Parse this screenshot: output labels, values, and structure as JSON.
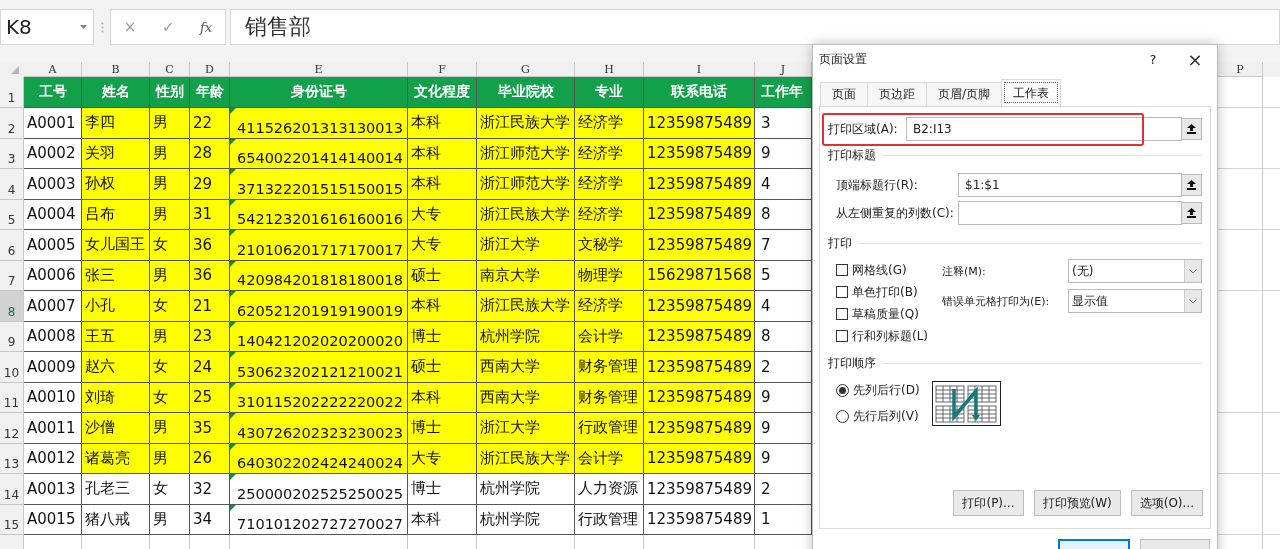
{
  "formula_bar": {
    "name_box": "K8",
    "buttons": [
      "×",
      "✓",
      "fx"
    ],
    "formula": "销售部"
  },
  "sheet": {
    "columns": [
      "A",
      "B",
      "C",
      "D",
      "E",
      "F",
      "G",
      "H",
      "I",
      "J"
    ],
    "far_column": "P",
    "header_row": {
      "row": "1",
      "cells": [
        "工号",
        "姓名",
        "性别",
        "年龄",
        "身份证号",
        "文化程度",
        "毕业院校",
        "专业",
        "联系电话",
        "工作年"
      ]
    },
    "rows": [
      {
        "row": "2",
        "active": false,
        "highlighted": true,
        "number_as_text": true,
        "cells": [
          "A0001",
          "李四",
          "男",
          "22",
          "411526201313130013",
          "本科",
          "浙江民族大学",
          "经济学",
          "12359875489",
          "3"
        ]
      },
      {
        "row": "3",
        "active": false,
        "highlighted": true,
        "number_as_text": true,
        "cells": [
          "A0002",
          "关羽",
          "男",
          "28",
          "654002201414140014",
          "本科",
          "浙江师范大学",
          "经济学",
          "12359875489",
          "9"
        ]
      },
      {
        "row": "4",
        "active": false,
        "highlighted": true,
        "number_as_text": true,
        "cells": [
          "A0003",
          "孙权",
          "男",
          "29",
          "371322201515150015",
          "本科",
          "浙江师范大学",
          "经济学",
          "12359875489",
          "4"
        ]
      },
      {
        "row": "5",
        "active": false,
        "highlighted": true,
        "number_as_text": true,
        "cells": [
          "A0004",
          "吕布",
          "男",
          "31",
          "542123201616160016",
          "大专",
          "浙江民族大学",
          "经济学",
          "12359875489",
          "8"
        ]
      },
      {
        "row": "6",
        "active": false,
        "highlighted": true,
        "number_as_text": true,
        "cells": [
          "A0005",
          "女儿国王",
          "女",
          "36",
          "210106201717170017",
          "大专",
          "浙江大学",
          "文秘学",
          "12359875489",
          "7"
        ]
      },
      {
        "row": "7",
        "active": false,
        "highlighted": true,
        "number_as_text": true,
        "cells": [
          "A0006",
          "张三",
          "男",
          "36",
          "420984201818180018",
          "硕士",
          "南京大学",
          "物理学",
          "15629871568",
          "5"
        ]
      },
      {
        "row": "8",
        "active": true,
        "highlighted": true,
        "number_as_text": true,
        "cells": [
          "A0007",
          "小孔",
          "女",
          "21",
          "620521201919190019",
          "本科",
          "浙江民族大学",
          "经济学",
          "12359875489",
          "4"
        ]
      },
      {
        "row": "9",
        "active": false,
        "highlighted": true,
        "number_as_text": true,
        "cells": [
          "A0008",
          "王五",
          "男",
          "23",
          "140421202020200020",
          "博士",
          "杭州学院",
          "会计学",
          "12359875489",
          "8"
        ]
      },
      {
        "row": "10",
        "active": false,
        "highlighted": true,
        "number_as_text": true,
        "cells": [
          "A0009",
          "赵六",
          "女",
          "24",
          "530623202121210021",
          "硕士",
          "西南大学",
          "财务管理",
          "12359875489",
          "2"
        ]
      },
      {
        "row": "11",
        "active": false,
        "highlighted": true,
        "number_as_text": true,
        "cells": [
          "A0010",
          "刘琦",
          "女",
          "25",
          "310115202222220022",
          "本科",
          "西南大学",
          "财务管理",
          "12359875489",
          "9"
        ]
      },
      {
        "row": "12",
        "active": false,
        "highlighted": true,
        "number_as_text": true,
        "cells": [
          "A0011",
          "沙僧",
          "男",
          "35",
          "430726202323230023",
          "博士",
          "浙江大学",
          "行政管理",
          "12359875489",
          "9"
        ]
      },
      {
        "row": "13",
        "active": false,
        "highlighted": true,
        "number_as_text": true,
        "cells": [
          "A0012",
          "诸葛亮",
          "男",
          "26",
          "640302202424240024",
          "大专",
          "浙江民族大学",
          "会计学",
          "12359875489",
          "9"
        ]
      },
      {
        "row": "14",
        "active": false,
        "highlighted": false,
        "number_as_text": true,
        "cells": [
          "A0013",
          "孔老三",
          "女",
          "32",
          "250000202525250025",
          "博士",
          "杭州学院",
          "人力资源",
          "12359875489",
          "2"
        ]
      },
      {
        "row": "15",
        "active": false,
        "highlighted": false,
        "number_as_text": true,
        "cells": [
          "A0015",
          "猪八戒",
          "男",
          "34",
          "710101202727270027",
          "本科",
          "杭州学院",
          "行政管理",
          "12359875489",
          "1"
        ]
      }
    ]
  },
  "dialog": {
    "title": "页面设置",
    "help": "?",
    "close": "×",
    "tabs": [
      {
        "label": "页面",
        "selected": false
      },
      {
        "label": "页边距",
        "selected": false
      },
      {
        "label": "页眉/页脚",
        "selected": false
      },
      {
        "label": "工作表",
        "selected": true
      }
    ],
    "print_area": {
      "label": "打印区域(A):",
      "value": "B2:I13"
    },
    "print_titles": {
      "heading": "打印标题",
      "fields": [
        {
          "label": "顶端标题行(R):",
          "value": "$1:$1"
        },
        {
          "label": "从左侧重复的列数(C):"
        }
      ]
    },
    "print": {
      "heading": "打印",
      "checkboxes": [
        {
          "label": "网格线(G)",
          "checked": false
        },
        {
          "label": "单色打印(B)",
          "checked": false
        },
        {
          "label": "草稿质量(Q)",
          "checked": false
        },
        {
          "label": "行和列标题(L)",
          "checked": false
        }
      ],
      "selects": [
        {
          "label": "注释(M):",
          "value": "(无)"
        },
        {
          "label": "错误单元格打印为(E):",
          "value": "显示值"
        }
      ]
    },
    "page_order": {
      "heading": "打印顺序",
      "options": [
        {
          "label": "先列后行(D)",
          "selected": true
        },
        {
          "label": "先行后列(V)",
          "selected": false
        }
      ]
    },
    "buttons": [
      "打印(P)...",
      "打印预览(W)",
      "选项(O)..."
    ]
  }
}
